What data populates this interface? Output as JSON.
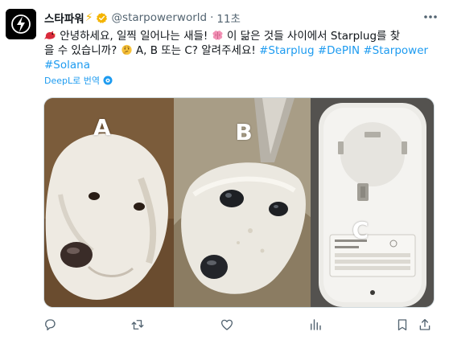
{
  "tweet": {
    "display_name": "스타파워",
    "bolt_emoji": "⚡",
    "handle": "@starpowerworld",
    "separator": "·",
    "time": "11초",
    "text_line1_pre": "안녕하세요, 일찍 일어나는 새들!",
    "text_line1_post": "이 닮은 것들 사이에서 Starplug를 찾",
    "text_line2_pre": "을 수 있습니까?",
    "text_line2_post": "A, B 또는 C? 알려주세요!",
    "hashtags_line2": [
      "#Starplug",
      "#DePIN",
      "#Starpower"
    ],
    "hashtags_line3": [
      "#Solana"
    ],
    "translate_label": "DeepL로 번역"
  },
  "media": {
    "labels": [
      "A",
      "B",
      "C"
    ],
    "descriptions": []
  },
  "icons": {
    "avatar": "starpower-logo-icon",
    "verified": "verified-badge-icon",
    "more": "more-icon",
    "translate": "gear-icon",
    "reply": "reply-icon",
    "retweet": "retweet-icon",
    "like": "heart-icon",
    "views": "views-icon",
    "bookmark": "bookmark-icon",
    "share": "share-icon"
  },
  "colors": {
    "link": "#1d9bf0",
    "secondary_text": "#536471",
    "verified": "#f4b400"
  }
}
